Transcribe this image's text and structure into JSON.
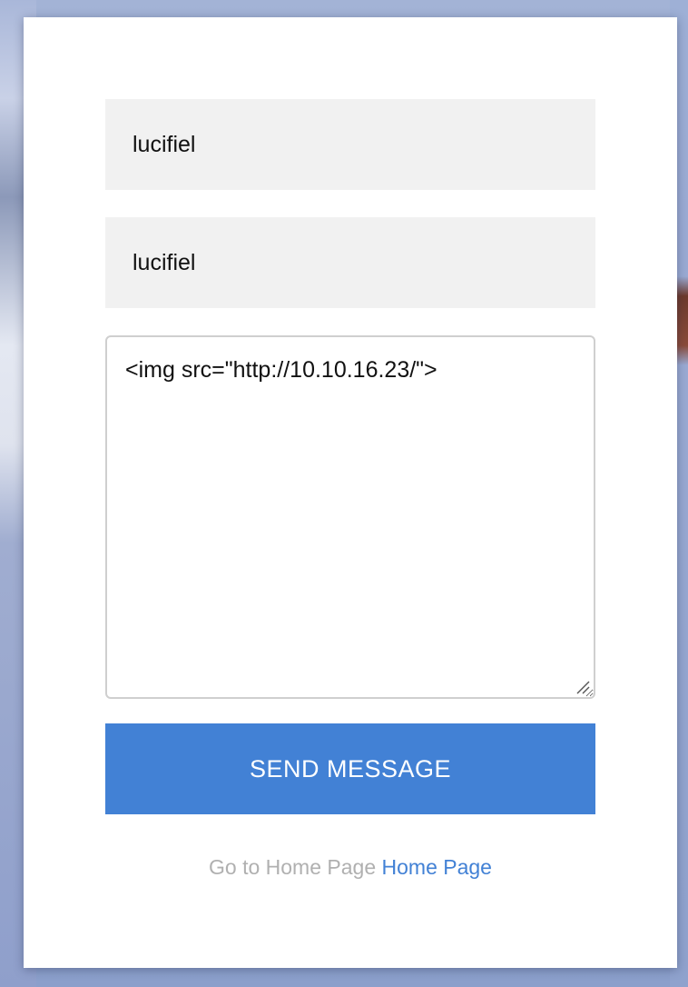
{
  "form": {
    "name_value": "lucifiel",
    "email_value": "lucifiel",
    "message_value": "<img src=\"http://10.10.16.23/\">",
    "send_label": "SEND MESSAGE"
  },
  "footer": {
    "text": "Go to Home Page",
    "link_label": "Home Page"
  },
  "colors": {
    "accent": "#4281d5",
    "field_background": "#f1f1f1",
    "muted_text": "#b0b0b0"
  }
}
